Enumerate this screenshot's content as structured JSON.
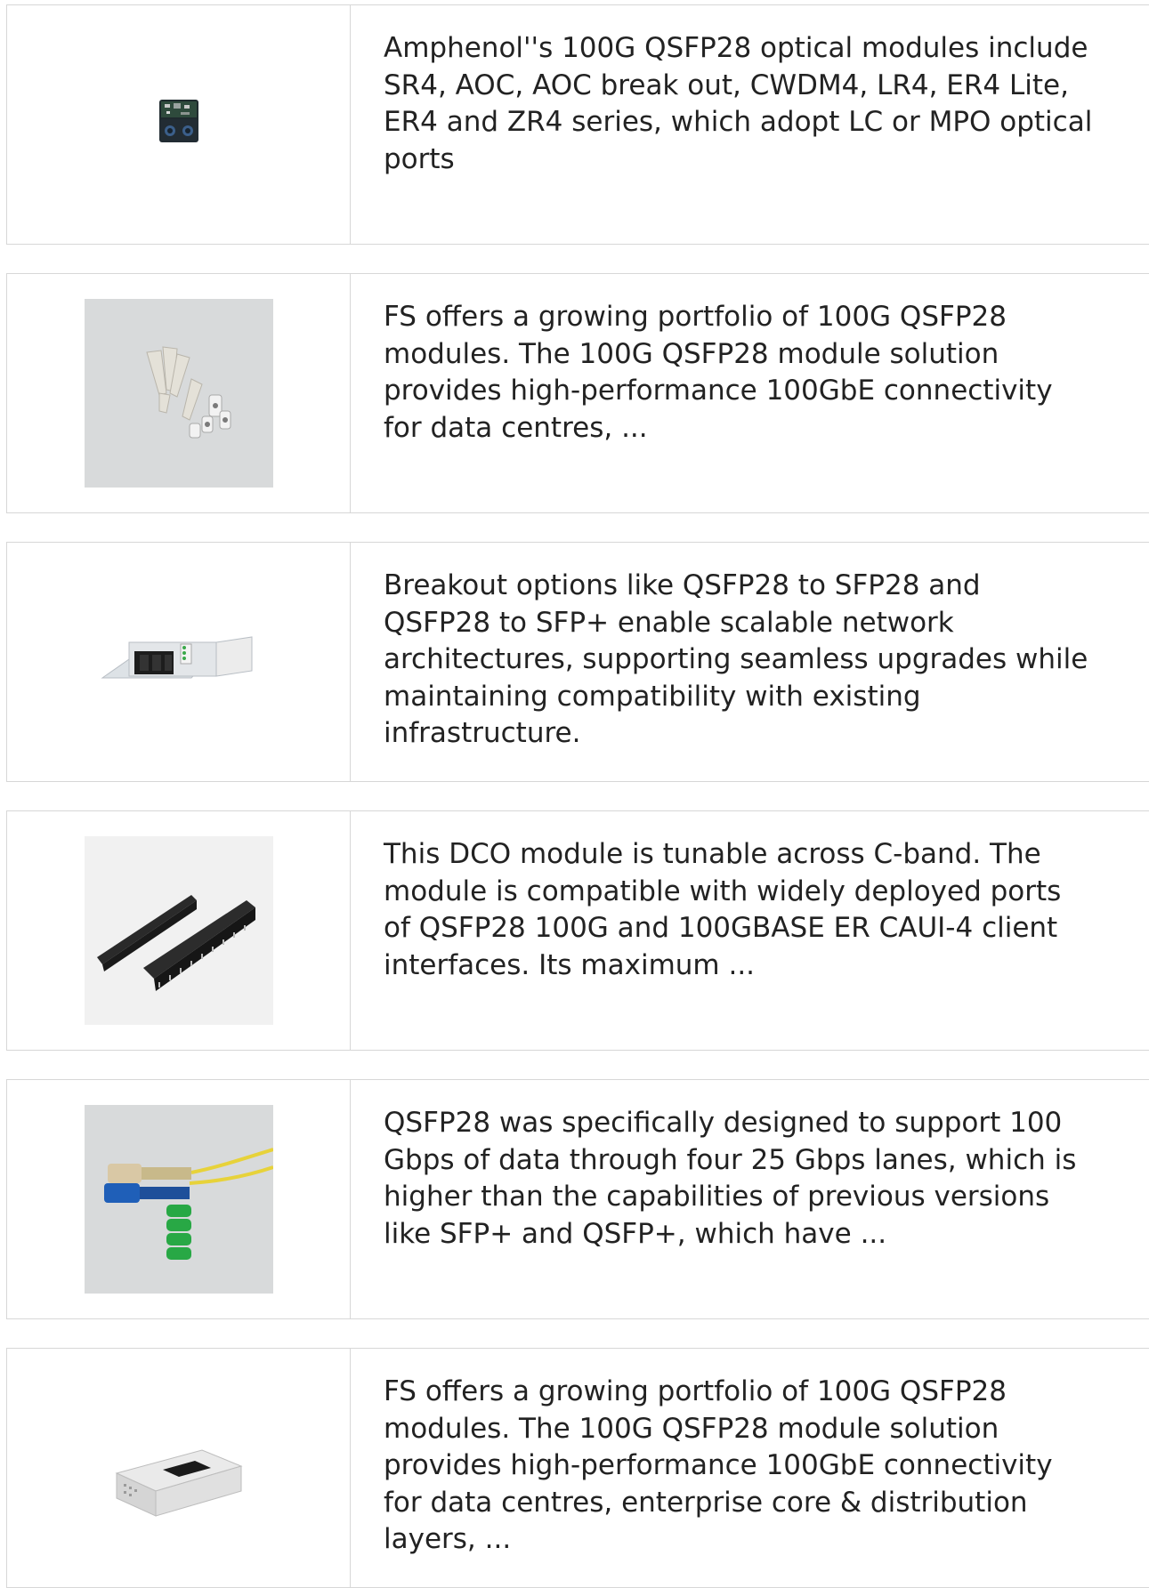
{
  "results": [
    {
      "thumbnail": "qsfp28-transceiver-icon",
      "description": "Amphenol''s 100G QSFP28 optical modules include\nSR4, AOC, AOC break out, CWDM4, LR4, ER4 Lite,\nER4 and ZR4 series, which adopt LC or MPO optical\nports"
    },
    {
      "thumbnail": "fiber-boots-icon",
      "description": "FS offers a growing portfolio of 100G QSFP28\nmodules. The 100G QSFP28 module solution\nprovides high-performance 100GbE connectivity\nfor data centres, ..."
    },
    {
      "thumbnail": "distribution-box-icon",
      "description": "Breakout options like QSFP28 to SFP28 and\nQSFP28 to SFP+ enable scalable network\narchitectures, supporting seamless upgrades while\nmaintaining compatibility with existing\ninfrastructure."
    },
    {
      "thumbnail": "cable-management-panel-icon",
      "description": "This DCO module is tunable across C-band. The\nmodule is compatible with widely deployed ports\nof QSFP28 100G and 100GBASE ER CAUI-4 client\ninterfaces. Its maximum ..."
    },
    {
      "thumbnail": "sc-patch-cord-icon",
      "description": "QSFP28 was specifically designed to support 100\nGbps of data through four 25 Gbps lanes, which is\nhigher than the capabilities of previous versions\nlike SFP+ and QSFP+, which have ..."
    },
    {
      "thumbnail": "media-converter-icon",
      "description": "FS offers a growing portfolio of 100G QSFP28\nmodules. The 100G QSFP28 module solution\nprovides high-performance 100GbE connectivity\nfor data centres, enterprise core & distribution\nlayers, ..."
    }
  ]
}
